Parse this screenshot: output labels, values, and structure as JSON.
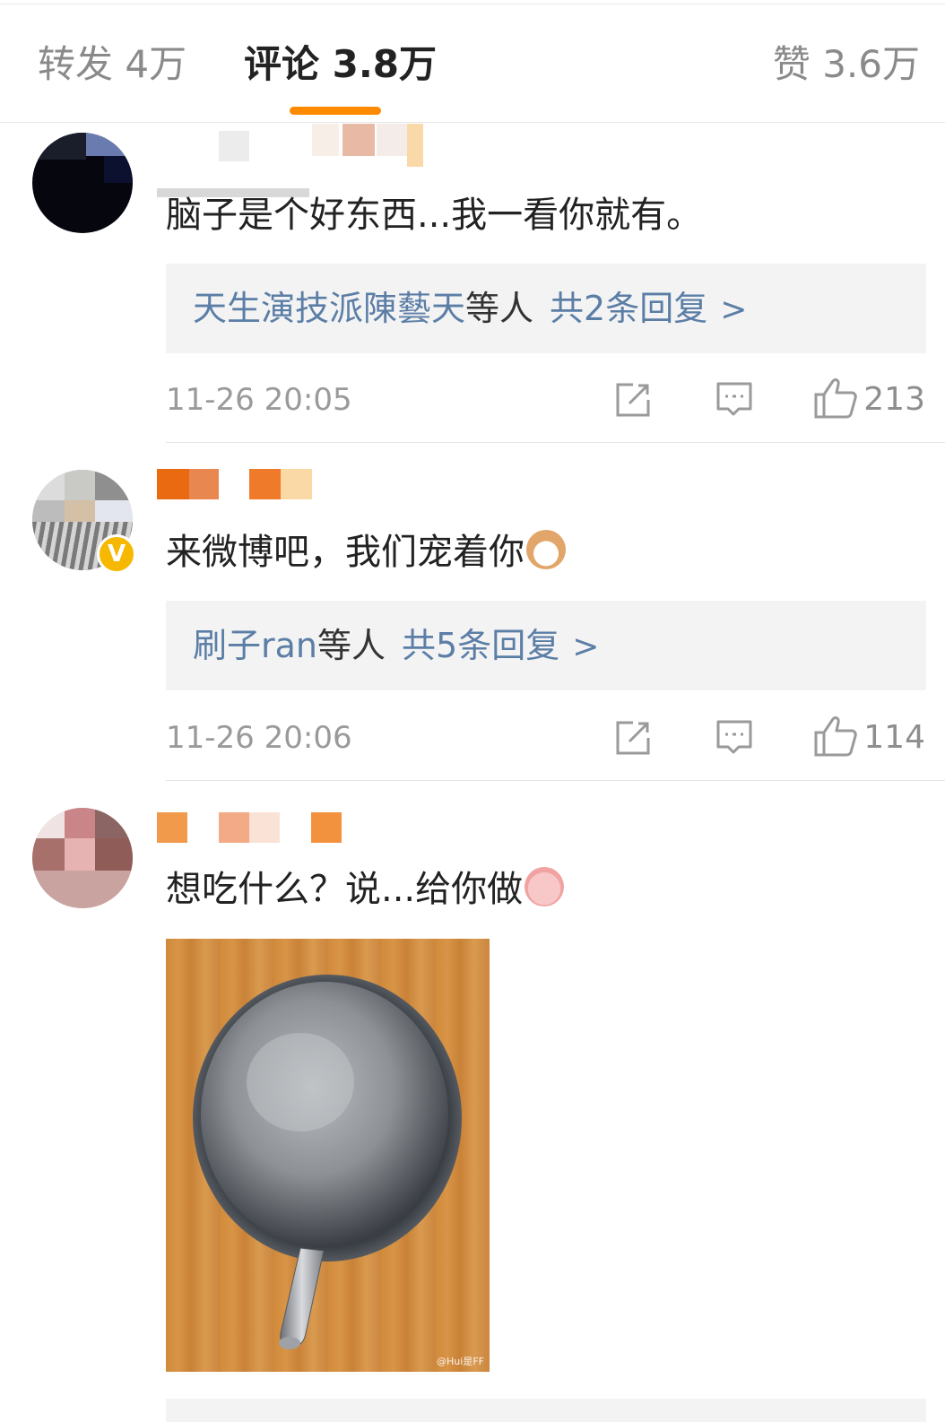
{
  "tabs": {
    "repost": "转发 4万",
    "comments": "评论 3.8万",
    "likes": "赞 3.6万"
  },
  "comments": [
    {
      "text": "脑子是个好东西...我一看你就有。",
      "reply_users": "天生演技派陳藝天",
      "reply_etc": "等人",
      "reply_count": "共2条回复",
      "reply_chevron": ">",
      "time": "11-26 20:05",
      "likes": "213",
      "verified": false
    },
    {
      "text": "来微博吧，我们宠着你",
      "emoji": "cat-face-emoji",
      "reply_users": "刷子ran",
      "reply_etc": "等人",
      "reply_count": "共5条回复",
      "reply_chevron": ">",
      "time": "11-26 20:06",
      "likes": "114",
      "verified": true,
      "badge": "V"
    },
    {
      "text": "想吃什么？说...给你做",
      "emoji": "cute-pig-emoji",
      "image": "wok-pan-photo",
      "watermark": "@Hui是FF"
    }
  ],
  "colors": {
    "accent": "#ff8a00",
    "link": "#5b7ea6",
    "meta": "#9a9a9a",
    "verified": "#f6b800"
  }
}
